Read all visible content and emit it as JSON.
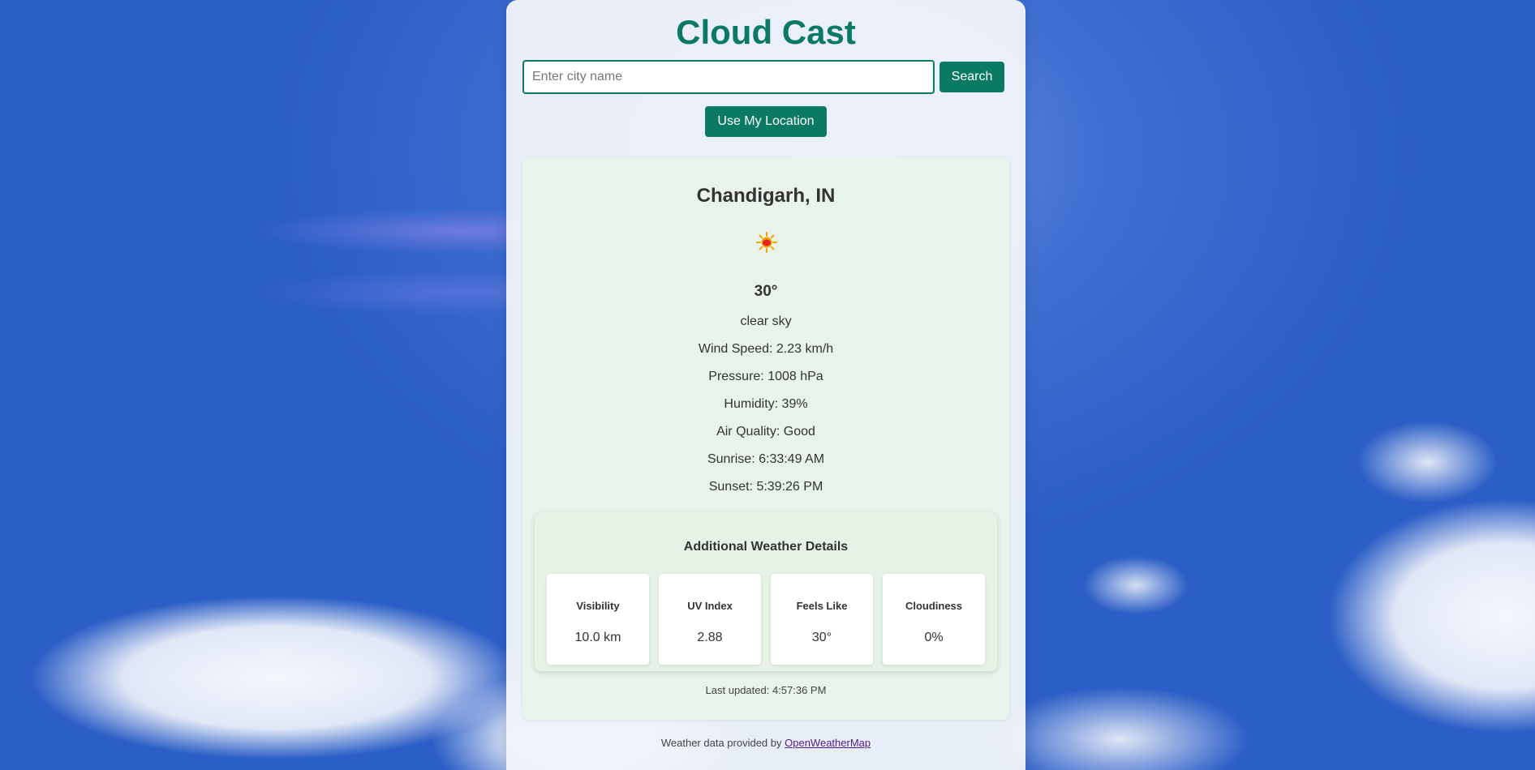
{
  "app": {
    "title": "Cloud Cast",
    "accent_color": "#0b7a63"
  },
  "search": {
    "placeholder": "Enter city name",
    "value": "",
    "button_label": "Search"
  },
  "location_button_label": "Use My Location",
  "weather": {
    "city": "Chandigarh, IN",
    "icon": "sun-icon",
    "temperature": "30°",
    "description": "clear sky",
    "wind_speed": "Wind Speed: 2.23 km/h",
    "pressure": "Pressure: 1008 hPa",
    "humidity": "Humidity: 39%",
    "air_quality": "Air Quality: Good",
    "sunrise": "Sunrise: 6:33:49 AM",
    "sunset": "Sunset: 5:39:26 PM"
  },
  "details": {
    "title": "Additional Weather Details",
    "items": [
      {
        "label": "Visibility",
        "value": "10.0 km"
      },
      {
        "label": "UV Index",
        "value": "2.88"
      },
      {
        "label": "Feels Like",
        "value": "30°"
      },
      {
        "label": "Cloudiness",
        "value": "0%"
      }
    ]
  },
  "last_updated": "Last updated: 4:57:36 PM",
  "footer": {
    "prefix": "Weather data provided by",
    "link_text": "OpenWeatherMap"
  }
}
